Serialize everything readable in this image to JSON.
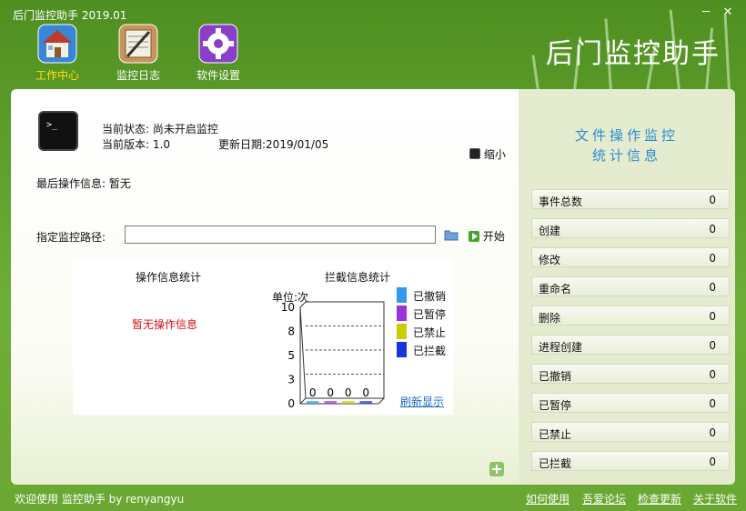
{
  "window": {
    "title": "后门监控助手 2019.01",
    "min": "─",
    "close": "✕"
  },
  "brand": "后门监控助手",
  "toolbar": [
    {
      "label": "工作中心",
      "icon": "house-icon",
      "active": true
    },
    {
      "label": "监控日志",
      "icon": "log-icon"
    },
    {
      "label": "软件设置",
      "icon": "gear-icon"
    }
  ],
  "status": {
    "current_state_label": "当前状态:",
    "current_state": "尚未开启监控",
    "version_label": "当前版本:",
    "version": "1.0",
    "update_label": "更新日期:",
    "update_date": "2019/01/05",
    "minimize": "缩小"
  },
  "last_op": {
    "label": "最后操作信息:",
    "value": "暂无"
  },
  "monitor": {
    "label": "指定监控路径:",
    "value": "",
    "start": "开始"
  },
  "op_stats": {
    "title": "操作信息统计",
    "empty": "暂无操作信息"
  },
  "block_stats": {
    "title": "拦截信息统计",
    "refresh": "刷新显示",
    "chart_data": {
      "type": "bar",
      "ylabel": "单位:次",
      "yticks": [
        "10",
        "8",
        "5",
        "3",
        "0"
      ],
      "ylim": [
        0,
        10
      ],
      "categories": [
        "已撤销",
        "已暂停",
        "已禁止",
        "已拦截"
      ],
      "values": [
        0,
        0,
        0,
        0
      ],
      "value_labels": [
        "0",
        "0",
        "0",
        "0"
      ],
      "colors": [
        "#3399ee",
        "#9933dd",
        "#cccc00",
        "#1a33dd"
      ],
      "legend_position": "right"
    }
  },
  "right_panel": {
    "title1": "文件操作监控",
    "title2": "统计信息",
    "stats": [
      {
        "k": "事件总数",
        "v": "0"
      },
      {
        "k": "创建",
        "v": "0"
      },
      {
        "k": "修改",
        "v": "0"
      },
      {
        "k": "重命名",
        "v": "0"
      },
      {
        "k": "删除",
        "v": "0"
      },
      {
        "k": "进程创建",
        "v": "0"
      },
      {
        "k": "已撤销",
        "v": "0"
      },
      {
        "k": "已暂停",
        "v": "0"
      },
      {
        "k": "已禁止",
        "v": "0"
      },
      {
        "k": "已拦截",
        "v": "0"
      }
    ]
  },
  "footer": {
    "welcome": "欢迎使用 监控助手  by  renyangyu",
    "links": [
      "如何使用",
      "吾爱论坛",
      "检查更新",
      "关于软件"
    ]
  }
}
